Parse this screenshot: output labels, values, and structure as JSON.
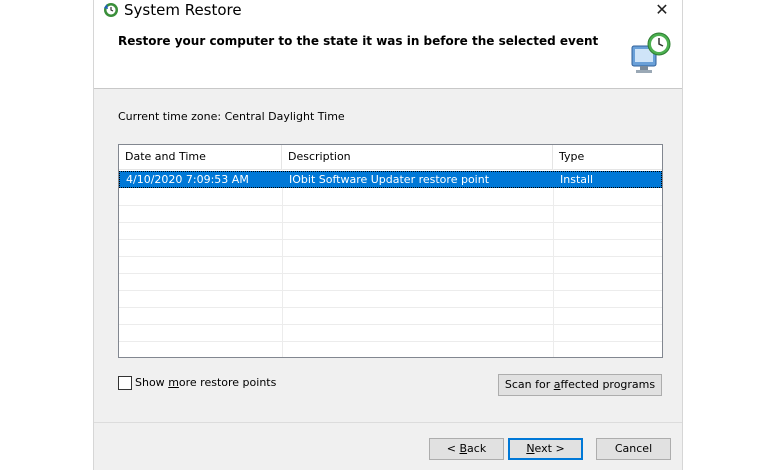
{
  "window": {
    "title": "System Restore",
    "close_glyph": "✕"
  },
  "header": {
    "text": "Restore your computer to the state it was in before the selected event"
  },
  "timezone": "Current time zone: Central Daylight Time",
  "table": {
    "columns": [
      "Date and Time",
      "Description",
      "Type"
    ],
    "rows": [
      {
        "date": "4/10/2020 7:09:53 AM",
        "description": "IObit Software Updater restore point",
        "type": "Install",
        "selected": true
      }
    ]
  },
  "checkbox": {
    "label_pre": "Show ",
    "label_access": "m",
    "label_post": "ore restore points",
    "checked": false
  },
  "buttons": {
    "scan_pre": "Scan for ",
    "scan_access": "a",
    "scan_post": "ffected programs",
    "back_pre": "< ",
    "back_access": "B",
    "back_post": "ack",
    "next_access": "N",
    "next_post": "ext >",
    "cancel": "Cancel"
  },
  "icons": {
    "title_icon": "system-restore-icon",
    "header_icon": "computer-restore-clock-icon",
    "sort_icon": "sort-arrow-icon"
  },
  "colors": {
    "selection": "#0078d7",
    "default_button_border": "#0078d7",
    "dialog_background": "#f0f0f0"
  }
}
